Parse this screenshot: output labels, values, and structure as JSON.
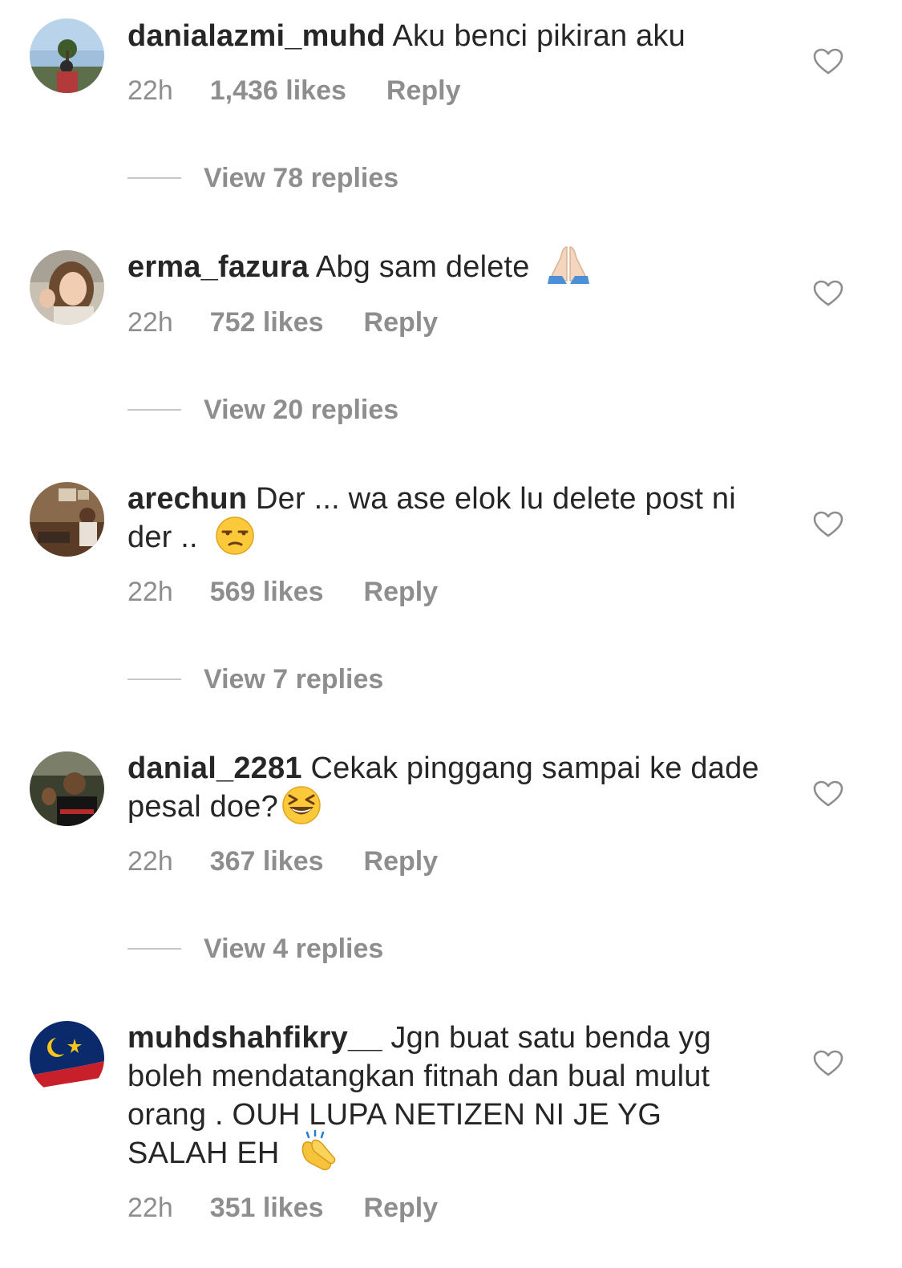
{
  "comments": [
    {
      "username": "danialazmi_muhd",
      "text": "Aku benci pikiran aku",
      "time": "22h",
      "likes": "1,436 likes",
      "reply": "Reply",
      "emoji": "",
      "view_replies": "View 78 replies"
    },
    {
      "username": "erma_fazura",
      "text": "Abg sam delete",
      "time": "22h",
      "likes": "752 likes",
      "reply": "Reply",
      "emoji": "folded-hands-icon",
      "view_replies": "View 20 replies"
    },
    {
      "username": "arechun",
      "text": "Der ... wa ase elok lu delete post ni der ..",
      "time": "22h",
      "likes": "569 likes",
      "reply": "Reply",
      "emoji": "unamused-face-icon",
      "view_replies": "View 7 replies"
    },
    {
      "username": "danial_2281",
      "text": "Cekak pinggang sampai ke dade pesal doe?",
      "time": "22h",
      "likes": "367 likes",
      "reply": "Reply",
      "emoji": "grinning-squinting-face-icon",
      "view_replies": "View 4 replies"
    },
    {
      "username": "muhdshahfikry__",
      "text": "Jgn buat satu benda yg boleh mendatangkan fitnah dan bual mulut orang . OUH LUPA NETIZEN NI JE YG SALAH EH",
      "time": "22h",
      "likes": "351 likes",
      "reply": "Reply",
      "emoji": "clapping-hands-icon",
      "view_replies": ""
    }
  ],
  "colors": {
    "text": "#262626",
    "muted": "#8e8e8e",
    "divider": "#c7c7c7"
  }
}
